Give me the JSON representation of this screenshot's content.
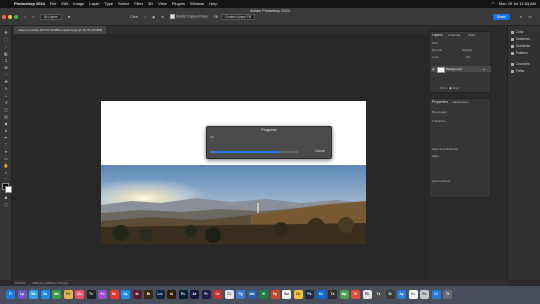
{
  "menubar": {
    "app_name": "Photoshop 2024",
    "items": [
      "File",
      "Edit",
      "Image",
      "Layer",
      "Type",
      "Select",
      "Filter",
      "3D",
      "View",
      "Plugins",
      "Window",
      "Help"
    ],
    "clock": "Mon 29 Jul 11:53 AM"
  },
  "window": {
    "title": "Adobe Photoshop 2024",
    "share_label": "Share"
  },
  "options_bar": {
    "sample_label": "Sample:",
    "sample_value": "All Layers",
    "sample_all_layers_label": "Sample All Layers",
    "delete_cropped_label": "Delete Cropped Pixels",
    "fill_label": "Fill:",
    "fill_value": "Content-Aware Fill",
    "clear_label": "Clear",
    "straighten_label": "Straighten"
  },
  "document_tab": {
    "label": "maxime-steckle-ZtKGSYMHBB-unsplash.jpg @ 16.7% (RGB/8)"
  },
  "progress": {
    "title": "Progress",
    "message": "Fill",
    "value_percent": 78,
    "cancel_label": "Cancel"
  },
  "layers_panel": {
    "tabs": [
      "Layers",
      "Channels",
      "Paths"
    ],
    "kind_label": "Kind",
    "mode_value": "Normal",
    "opacity_label": "Opacity:",
    "lock_label": "Lock:",
    "fill_label": "Fill:",
    "layer_name": "Background"
  },
  "properties_panel": {
    "tabs": [
      "Properties",
      "Adjustments"
    ],
    "pixel_layer_label": "Pixel Layer",
    "transform_label": "Transform",
    "align_label": "Align and Distribute",
    "align_sub": "Align:",
    "quick_actions_label": "Quick Actions"
  },
  "right_dock": {
    "items": [
      "Color",
      "Swatches",
      "Gradients",
      "Patterns",
      "Channels",
      "Paths"
    ]
  },
  "status_bar": {
    "zoom": "16.67%",
    "doc_info": "4032 px x 2268 px (72 ppi)"
  },
  "dock_apps": [
    {
      "label": "Fi",
      "color": "#1e7ae6"
    },
    {
      "label": "Lp",
      "color": "#6a55c9"
    },
    {
      "label": "Ms",
      "color": "#2da2e5"
    },
    {
      "label": "Sa",
      "color": "#1a8bf0"
    },
    {
      "label": "Ma",
      "color": "#3a9e4a"
    },
    {
      "label": "Ph",
      "color": "#e6b34a"
    },
    {
      "label": "Mu",
      "color": "#f44f6a"
    },
    {
      "label": "Tv",
      "color": "#222"
    },
    {
      "label": "Po",
      "color": "#9a4bd1"
    },
    {
      "label": "Ne",
      "color": "#e8362c"
    },
    {
      "label": "Ap",
      "color": "#1f8ff0"
    },
    {
      "label": "Id",
      "color": "#5a1d2f"
    },
    {
      "label": "Br",
      "color": "#3a2a14"
    },
    {
      "label": "Lrc",
      "color": "#0a2440"
    },
    {
      "label": "Ai",
      "color": "#331b00"
    },
    {
      "label": "Ps",
      "color": "#001e36"
    },
    {
      "label": "Ae",
      "color": "#1d1741"
    },
    {
      "label": "Pr",
      "color": "#1f1b4d"
    },
    {
      "label": "Cc",
      "color": "#c8302c"
    },
    {
      "label": "Cl",
      "color": "#e0e6f0"
    },
    {
      "label": "Pg",
      "color": "#3b7ad8"
    },
    {
      "label": "Wd",
      "color": "#2b5fa9"
    },
    {
      "label": "Xl",
      "color": "#1f7a44"
    },
    {
      "label": "Pp",
      "color": "#c5492b"
    },
    {
      "label": "Gm",
      "color": "#f5f5f5"
    },
    {
      "label": "Ch",
      "color": "#f0c13a"
    },
    {
      "label": "Ps",
      "color": "#1d2b48"
    },
    {
      "label": "Ov",
      "color": "#0c6adf"
    },
    {
      "label": "Tk",
      "color": "#2f2f2f"
    },
    {
      "label": "Mp",
      "color": "#4ba34c"
    },
    {
      "label": "Cl",
      "color": "#e24a3b"
    },
    {
      "label": "Ph",
      "color": "#e4e4e4"
    },
    {
      "label": "Tx",
      "color": "#4d4d4d"
    },
    {
      "label": "St",
      "color": "#3a3a3a"
    },
    {
      "label": "Ap",
      "color": "#2a78e4"
    },
    {
      "label": "Ki",
      "color": "#ffffff"
    },
    {
      "label": "Fn",
      "color": "#c8c8c8"
    },
    {
      "label": "Dl",
      "color": "#1c7ce4"
    },
    {
      "label": "Tr",
      "color": "#6b6b6b"
    }
  ]
}
